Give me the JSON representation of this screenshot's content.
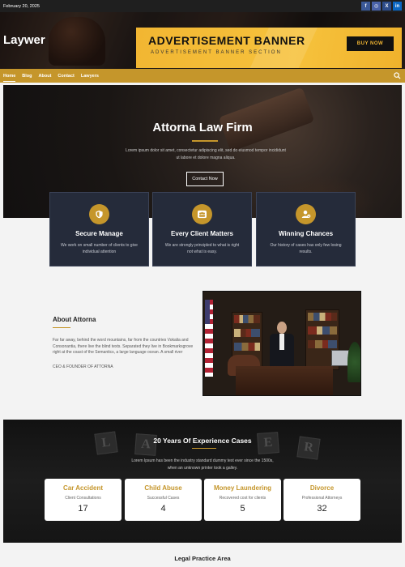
{
  "topbar": {
    "date": "February 20, 2025",
    "socials": [
      {
        "label": "f",
        "icon": "facebook-icon"
      },
      {
        "label": "◎",
        "icon": "instagram-icon"
      },
      {
        "label": "X",
        "icon": "x-icon"
      },
      {
        "label": "in",
        "icon": "linkedin-icon"
      }
    ]
  },
  "header": {
    "brand": "Laywer",
    "ad": {
      "title": "ADVERTISEMENT BANNER",
      "subtitle": "ADVERTISEMENT BANNER SECTION",
      "button": "BUY NOW"
    }
  },
  "nav": {
    "items": [
      "Home",
      "Blog",
      "About",
      "Contact",
      "Lawyers"
    ],
    "active": "Home"
  },
  "hero": {
    "title": "Attorna Law Firm",
    "text": "Lorem ipsum dolor sit amet, consectetur adipiscing elit, sed do eiusmod tempor incididunt ut labore et dolore magna aliqua.",
    "button": "Contact Now"
  },
  "features": [
    {
      "title": "Secure Manage",
      "text": "We work on small number of clients to give individual attention",
      "icon": "shield-icon"
    },
    {
      "title": "Every Client Matters",
      "text": "We are strongly principled to what is right not what is easy.",
      "icon": "group-icon"
    },
    {
      "title": "Winning Chances",
      "text": "Our history of cases has only few losing results.",
      "icon": "user-check-icon"
    }
  ],
  "about": {
    "title": "About Attorna",
    "body": "Far far away, behind the word mountains, far from the countries Vokalia and Consonantia, there live the blind texts. Separated they live in Bookmarksgrove right at the coast of the Semantics, a large language ocean. A small river",
    "ceo": "CEO & FOUNDER OF ATTORNA"
  },
  "experience": {
    "title": "20 Years Of Experience Cases",
    "text": "Lorem Ipsum has been the industry standard dummy text ever since the 1500s, when an unknown printer took a galley.",
    "tiles": [
      "L",
      "A",
      "E",
      "R"
    ],
    "stats": [
      {
        "title": "Car Accident",
        "subtitle": "Client Consultations",
        "value": "17"
      },
      {
        "title": "Child Abuse",
        "subtitle": "Successful Cases",
        "value": "4"
      },
      {
        "title": "Money Laundering",
        "subtitle": "Recovered cost for clients",
        "value": "5"
      },
      {
        "title": "Divorce",
        "subtitle": "Professional Attorneys",
        "value": "32"
      }
    ]
  },
  "legal": {
    "title": "Legal Practice Area"
  },
  "colors": {
    "accent": "#c5962b",
    "ad_yellow": "#f2b632",
    "card_bg": "#252b3a"
  }
}
